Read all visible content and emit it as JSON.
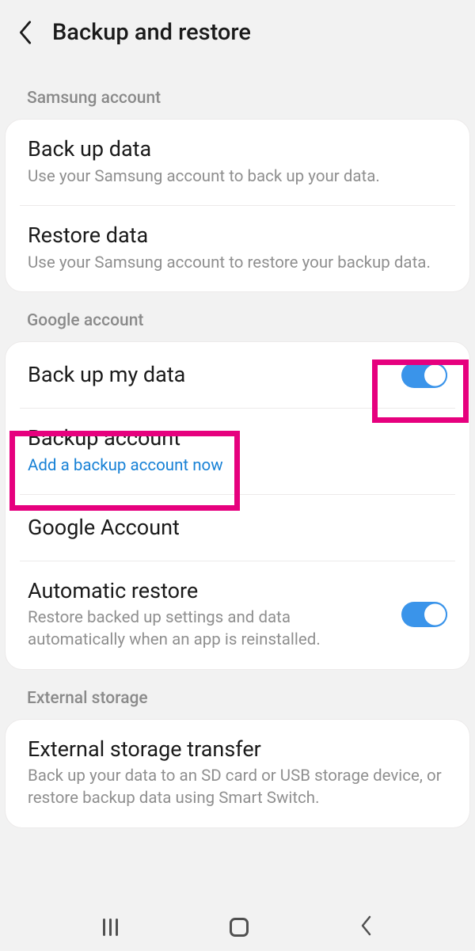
{
  "header": {
    "title": "Backup and restore"
  },
  "sections": {
    "samsung": {
      "label": "Samsung account",
      "backup_title": "Back up data",
      "backup_sub": "Use your Samsung account to back up your data.",
      "restore_title": "Restore data",
      "restore_sub": "Use your Samsung account to restore your backup data."
    },
    "google": {
      "label": "Google account",
      "backup_my_data": "Back up my data",
      "backup_account_title": "Backup account",
      "backup_account_sub": "Add a backup account now",
      "google_account": "Google Account",
      "auto_restore_title": "Automatic restore",
      "auto_restore_sub": "Restore backed up settings and data automatically when an app is reinstalled."
    },
    "external": {
      "label": "External storage",
      "transfer_title": "External storage transfer",
      "transfer_sub": "Back up your data to an SD card or USB storage device, or restore backup data using Smart Switch."
    }
  },
  "toggles": {
    "backup_my_data": true,
    "automatic_restore": true
  }
}
